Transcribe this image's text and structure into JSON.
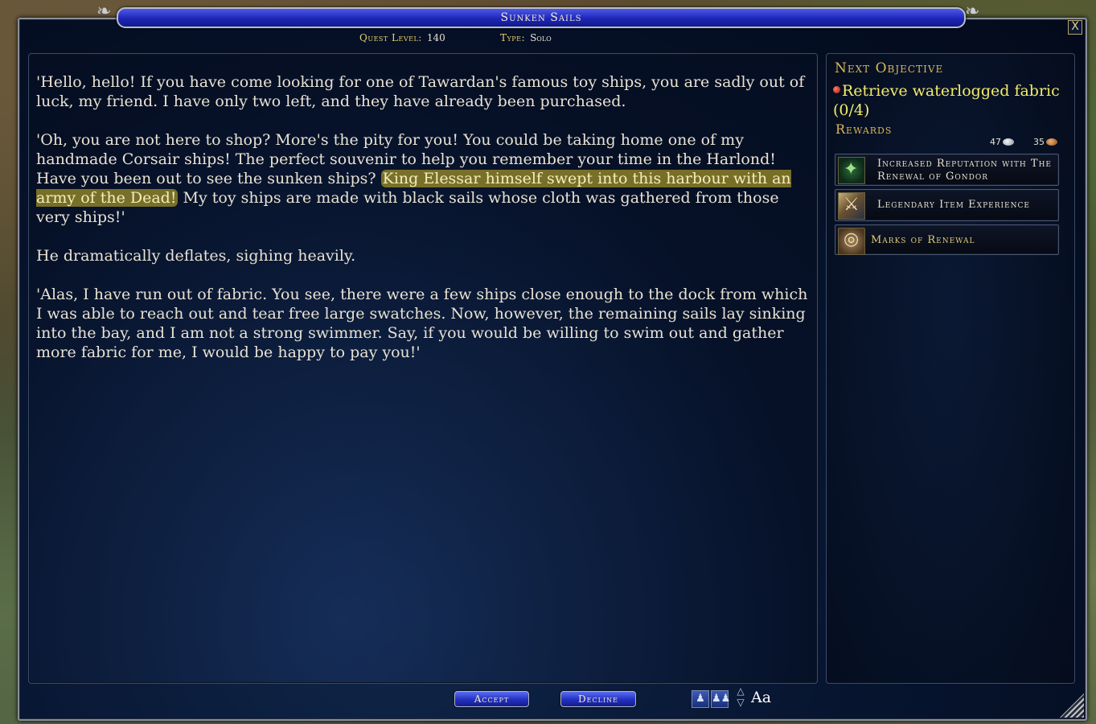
{
  "window": {
    "title": "Sunken Sails",
    "close_label": "X"
  },
  "meta": {
    "level_label": "Quest Level:",
    "level_value": "140",
    "type_label": "Type:",
    "type_value": "Solo"
  },
  "dialog": {
    "p1": "'Hello, hello! If you have come looking for one of Tawardan's famous toy ships, you are sadly out of luck, my friend. I have only two left, and they have already been purchased.",
    "p2_before": "'Oh, you are not here to shop? More's the pity for you! You could be taking home one of my handmade Corsair ships! The perfect souvenir to help you remember your time in the Harlond! Have you been out to see the sunken ships? ",
    "p2_highlight": "King Elessar himself swept into this harbour with an army of the Dead!",
    "p2_after": " My toy ships are made with black sails whose cloth was gathered from those very ships!'",
    "p3": "He dramatically deflates, sighing heavily.",
    "p4": "'Alas, I have run out of fabric. You see, there were a few ships close enough to the dock from which I was able to reach out and tear free large swatches. Now, however, the remaining sails lay sinking into the bay, and I am not a strong swimmer. Say, if you would be willing to swim out and gather more fabric for me, I would be happy to pay you!'"
  },
  "side": {
    "next_objective_head": "Next Objective",
    "objective_text": "Retrieve waterlogged fabric (0/4)",
    "rewards_head": "Rewards",
    "silver": "47",
    "copper": "35",
    "rewards": [
      {
        "label": "Increased Reputation with The Renewal of Gondor",
        "icon": "reputation-icon"
      },
      {
        "label": "Legendary Item Experience",
        "icon": "legendary-item-icon"
      },
      {
        "label": "Marks of Renewal",
        "icon": "marks-of-renewal-icon"
      }
    ]
  },
  "buttons": {
    "accept": "Accept",
    "decline": "Decline"
  },
  "tools": {
    "font_label": "Aa"
  },
  "colors": {
    "title_bar": "#1e26b8",
    "highlight": "#bea928",
    "objective": "#f4ec6a",
    "section_head": "#d9b75a"
  }
}
